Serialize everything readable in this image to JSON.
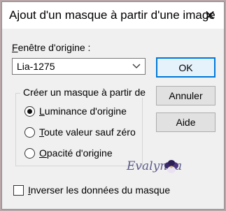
{
  "dialog": {
    "title": "Ajout d'un masque à partir d'une image",
    "close_icon": "close-icon"
  },
  "source": {
    "label_first": "F",
    "label_rest": "enêtre d'origine :",
    "selected": "Lia-1275",
    "dropdown_icon": "chevron-down-icon"
  },
  "buttons": {
    "ok": "OK",
    "cancel": "Annuler",
    "help": "Aide"
  },
  "group": {
    "label": "Créer un masque à partir de",
    "options": [
      {
        "underline": "L",
        "rest": "uminance d'origine",
        "selected": true
      },
      {
        "underline": "T",
        "rest": "oute valeur sauf zéro",
        "selected": false
      },
      {
        "underline": "O",
        "rest": "pacité d'origine",
        "selected": false
      }
    ]
  },
  "invert": {
    "underline": "I",
    "rest": "nverser les données du masque",
    "checked": false
  },
  "watermark": {
    "text": "Evalynda",
    "icon": "pansy-flower-icon"
  },
  "colors": {
    "accent": "#0078d7",
    "background": "#f0f0f0",
    "outer": "#b9a6a8"
  }
}
